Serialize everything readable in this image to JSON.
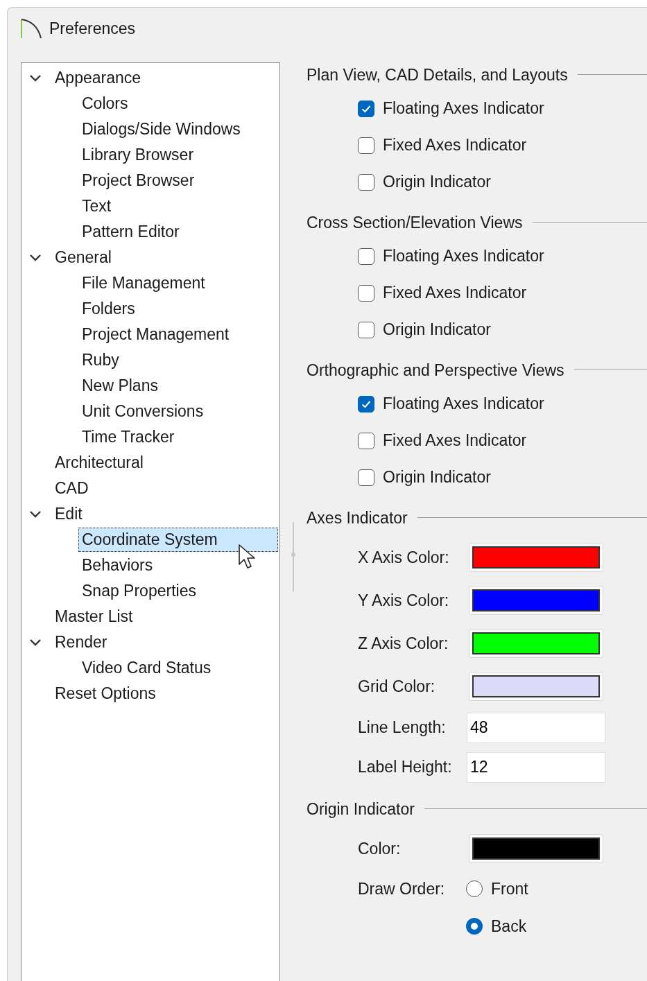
{
  "window": {
    "title": "Preferences"
  },
  "tree": [
    {
      "label": "Appearance",
      "expanded": true,
      "selected": false,
      "children": [
        {
          "label": "Colors",
          "selected": false
        },
        {
          "label": "Dialogs/Side Windows",
          "selected": false
        },
        {
          "label": "Library Browser",
          "selected": false
        },
        {
          "label": "Project Browser",
          "selected": false
        },
        {
          "label": "Text",
          "selected": false
        },
        {
          "label": "Pattern Editor",
          "selected": false
        }
      ]
    },
    {
      "label": "General",
      "expanded": true,
      "selected": false,
      "children": [
        {
          "label": "File Management",
          "selected": false
        },
        {
          "label": "Folders",
          "selected": false
        },
        {
          "label": "Project Management",
          "selected": false
        },
        {
          "label": "Ruby",
          "selected": false
        },
        {
          "label": "New Plans",
          "selected": false
        },
        {
          "label": "Unit Conversions",
          "selected": false
        },
        {
          "label": "Time Tracker",
          "selected": false
        }
      ]
    },
    {
      "label": "Architectural",
      "selected": false
    },
    {
      "label": "CAD",
      "selected": false
    },
    {
      "label": "Edit",
      "expanded": true,
      "selected": false,
      "children": [
        {
          "label": "Coordinate System",
          "selected": true
        },
        {
          "label": "Behaviors",
          "selected": false
        },
        {
          "label": "Snap Properties",
          "selected": false
        }
      ]
    },
    {
      "label": "Master List",
      "selected": false
    },
    {
      "label": "Render",
      "expanded": true,
      "selected": false,
      "children": [
        {
          "label": "Video Card Status",
          "selected": false
        }
      ]
    },
    {
      "label": "Reset Options",
      "selected": false
    }
  ],
  "sections": [
    {
      "title": "Plan View, CAD Details, and Layouts",
      "rows": [
        {
          "kind": "checkbox",
          "label": "Floating Axes Indicator",
          "checked": true
        },
        {
          "kind": "checkbox",
          "label": "Fixed Axes Indicator",
          "checked": false
        },
        {
          "kind": "checkbox",
          "label": "Origin Indicator",
          "checked": false
        }
      ]
    },
    {
      "title": "Cross Section/Elevation Views",
      "rows": [
        {
          "kind": "checkbox",
          "label": "Floating Axes Indicator",
          "checked": false
        },
        {
          "kind": "checkbox",
          "label": "Fixed Axes Indicator",
          "checked": false
        },
        {
          "kind": "checkbox",
          "label": "Origin Indicator",
          "checked": false
        }
      ]
    },
    {
      "title": "Orthographic and Perspective Views",
      "rows": [
        {
          "kind": "checkbox",
          "label": "Floating Axes Indicator",
          "checked": true
        },
        {
          "kind": "checkbox",
          "label": "Fixed Axes Indicator",
          "checked": false
        },
        {
          "kind": "checkbox",
          "label": "Origin Indicator",
          "checked": false
        }
      ]
    },
    {
      "title": "Axes Indicator",
      "rows": [
        {
          "kind": "color",
          "label": "X Axis Color:",
          "color": "#ff0000"
        },
        {
          "kind": "color",
          "label": "Y Axis Color:",
          "color": "#0000ff"
        },
        {
          "kind": "color",
          "label": "Z Axis Color:",
          "color": "#00ff00"
        },
        {
          "kind": "color",
          "label": "Grid Color:",
          "color": "#dcdcfa"
        },
        {
          "kind": "number",
          "label": "Line Length:",
          "value": "48"
        },
        {
          "kind": "number",
          "label": "Label Height:",
          "value": "12"
        }
      ]
    },
    {
      "title": "Origin Indicator",
      "rows": [
        {
          "kind": "color",
          "label": "Color:",
          "color": "#000000"
        },
        {
          "kind": "radio",
          "label": "Draw Order:",
          "options": [
            {
              "label": "Front",
              "selected": false
            },
            {
              "label": "Back",
              "selected": true
            }
          ]
        }
      ]
    }
  ]
}
